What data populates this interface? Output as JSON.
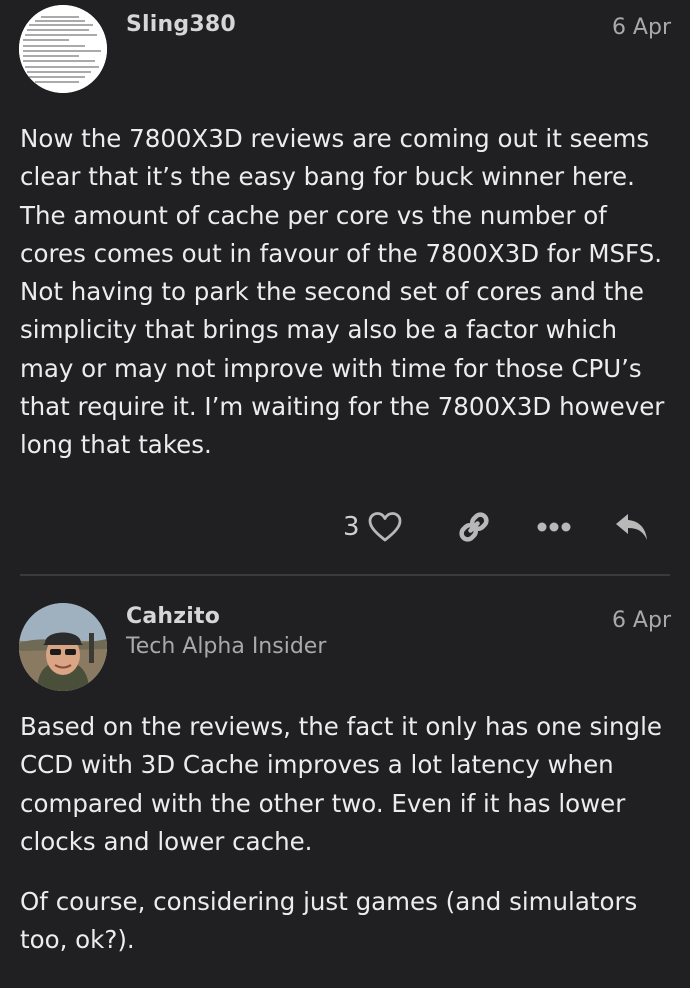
{
  "posts": [
    {
      "username": "Sling380",
      "date": "6 Apr",
      "avatar_icon": "code-screenshot-avatar",
      "body": [
        "Now the 7800X3D reviews are coming out it seems clear that it’s the easy bang for buck winner here. The amount of cache per core vs the number of cores comes out in favour of the 7800X3D for MSFS. Not having to park the second set of cores and the simplicity that brings may also be a factor which may or may not improve with time for those CPU’s that require it. I’m waiting for the 7800X3D however long that takes."
      ],
      "actions": {
        "like_count": "3",
        "icons": [
          "heart-icon",
          "link-icon",
          "more-icon",
          "reply-icon"
        ]
      }
    },
    {
      "username": "Cahzito",
      "user_title": "Tech Alpha Insider",
      "date": "6 Apr",
      "avatar_icon": "user-photo-avatar",
      "body": [
        "Based on the reviews, the fact it only has one single CCD with 3D Cache improves a lot latency when compared with the other two. Even if it has lower clocks and lower cache.",
        "Of course, considering just games (and simulators too, ok?)."
      ]
    }
  ],
  "colors": {
    "background": "#202022",
    "text": "#ececec",
    "muted": "#a9a9a9",
    "icon": "#b8b8b8",
    "divider": "#3a3a3c"
  }
}
